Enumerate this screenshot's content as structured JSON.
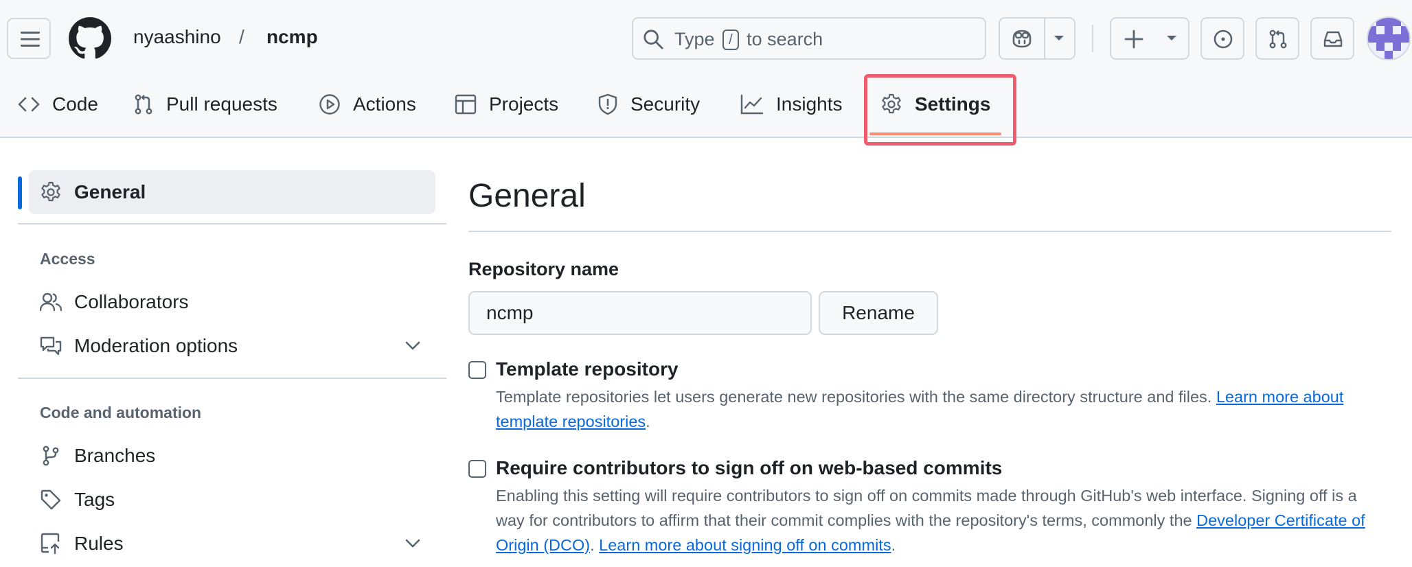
{
  "header": {
    "owner": "nyaashino",
    "separator": "/",
    "repo": "ncmp",
    "search": {
      "prefix": "Type",
      "key": "/",
      "suffix": "to search"
    }
  },
  "tabs": [
    {
      "label": "Code",
      "icon": "code-icon"
    },
    {
      "label": "Pull requests",
      "icon": "git-pull-request-icon"
    },
    {
      "label": "Actions",
      "icon": "play-icon"
    },
    {
      "label": "Projects",
      "icon": "table-icon"
    },
    {
      "label": "Security",
      "icon": "shield-icon"
    },
    {
      "label": "Insights",
      "icon": "graph-icon"
    },
    {
      "label": "Settings",
      "icon": "gear-icon",
      "selected": true
    }
  ],
  "sidebar": {
    "active": {
      "label": "General",
      "icon": "gear-icon"
    },
    "sections": [
      {
        "heading": "Access",
        "items": [
          {
            "label": "Collaborators",
            "icon": "people-icon"
          },
          {
            "label": "Moderation options",
            "icon": "comment-discussion-icon",
            "expandable": true
          }
        ]
      },
      {
        "heading": "Code and automation",
        "items": [
          {
            "label": "Branches",
            "icon": "git-branch-icon"
          },
          {
            "label": "Tags",
            "icon": "tag-icon"
          },
          {
            "label": "Rules",
            "icon": "repo-push-icon",
            "expandable": true
          }
        ]
      }
    ]
  },
  "main": {
    "title": "General",
    "repo_name_label": "Repository name",
    "repo_name_value": "ncmp",
    "rename_label": "Rename",
    "options": [
      {
        "title": "Template repository",
        "desc": "Template repositories let users generate new repositories with the same directory structure and files.",
        "link": "Learn more about template repositories",
        "checked": false
      },
      {
        "title": "Require contributors to sign off on web-based commits",
        "desc": "Enabling this setting will require contributors to sign off on commits made through GitHub's web interface. Signing off is a way for contributors to affirm that their commit complies with the repository's terms, commonly the",
        "link1": "Developer Certificate of Origin (DCO)",
        "link2": "Learn more about signing off on commits",
        "checked": false
      }
    ]
  },
  "colors": {
    "accent": "#0969da",
    "tab_underline": "#fd8c73",
    "highlight": "#ef5b6e"
  }
}
